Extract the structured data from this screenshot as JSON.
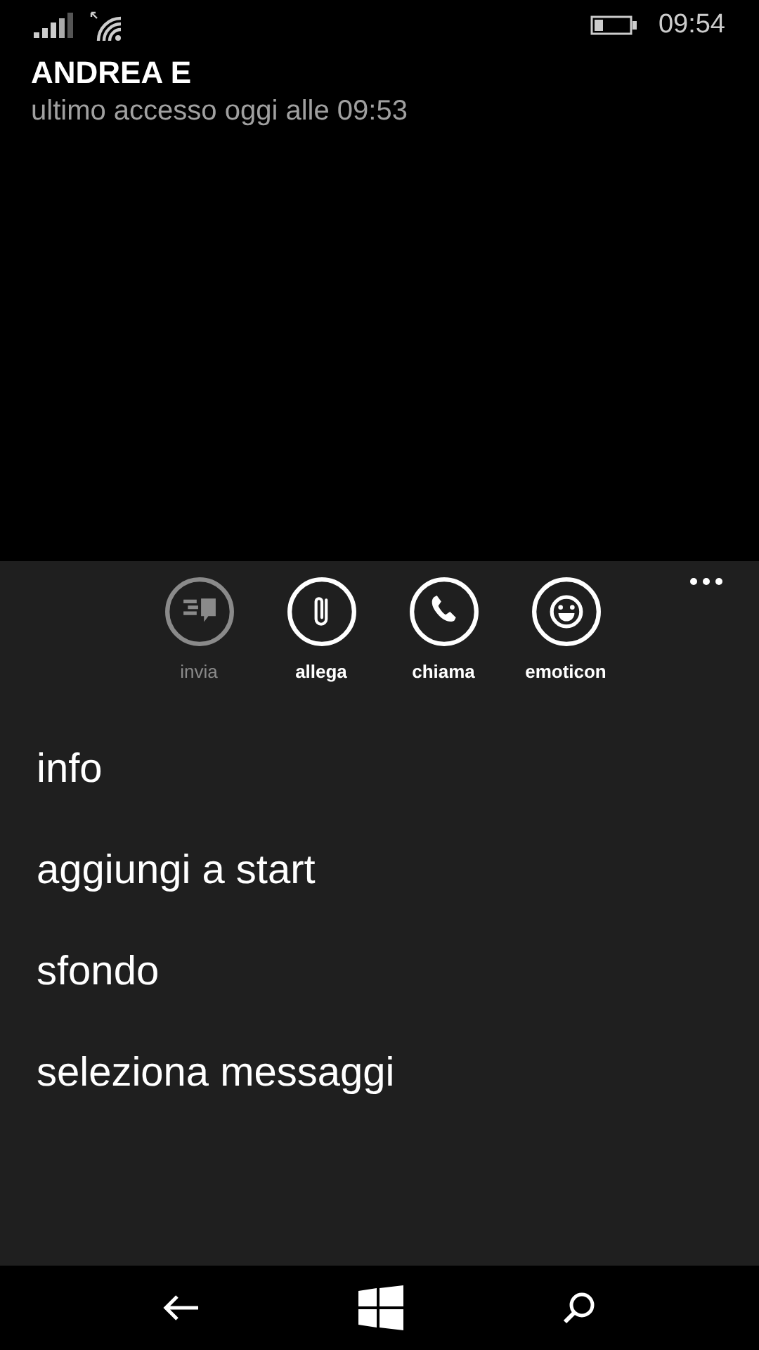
{
  "status_bar": {
    "time": "09:54"
  },
  "contact": {
    "name": "ANDREA E",
    "last_seen": "ultimo accesso oggi alle 09:53"
  },
  "app_bar": {
    "buttons": [
      {
        "kind": "send",
        "label": "invia",
        "disabled": true
      },
      {
        "kind": "attach",
        "label": "allega",
        "disabled": false
      },
      {
        "kind": "call",
        "label": "chiama",
        "disabled": false
      },
      {
        "kind": "emoji",
        "label": "emoticon",
        "disabled": false
      }
    ],
    "menu": [
      "info",
      "aggiungi a start",
      "sfondo",
      "seleziona messaggi"
    ]
  }
}
